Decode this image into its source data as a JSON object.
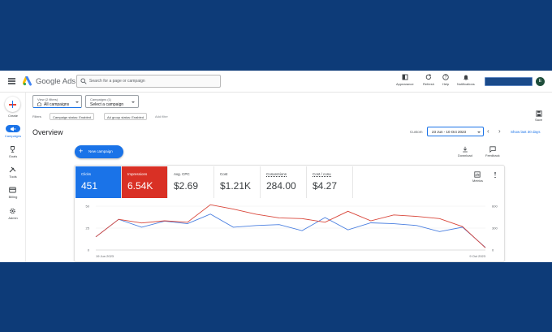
{
  "header": {
    "brand": "Google Ads",
    "search_placeholder": "Search for a page or campaign",
    "tools": [
      {
        "icon": "appearance-icon",
        "label": "Appearance"
      },
      {
        "icon": "refresh-icon",
        "label": "Refresh"
      },
      {
        "icon": "help-icon",
        "label": "Help"
      },
      {
        "icon": "bell-icon",
        "label": "Notifications"
      }
    ],
    "avatar_initial": "E"
  },
  "leftnav": {
    "create_label": "Create",
    "items": [
      {
        "icon": "campaigns-icon",
        "label": "Campaigns",
        "active": true
      },
      {
        "icon": "trophy-icon",
        "label": "Goals"
      },
      {
        "icon": "tools-icon",
        "label": "Tools"
      },
      {
        "icon": "card-icon",
        "label": "Billing"
      },
      {
        "icon": "gear-icon",
        "label": "Admin"
      }
    ]
  },
  "filters": {
    "view_label": "View (2 filters)",
    "view_value": "All campaigns",
    "campaigns_label": "Campaigns (1)",
    "campaigns_value": "Select a campaign",
    "filters_label": "Filters",
    "chips": [
      "Campaign status: Enabled",
      "Ad group status: Enabled"
    ],
    "add_filter": "Add filter",
    "save_label": "Save"
  },
  "overview": {
    "title": "Overview",
    "custom_label": "Custom",
    "date_range": "23 Jun - 10 Oct 2023",
    "show_last": "Show last 30 days",
    "new_campaign": "New campaign",
    "download": "Download",
    "feedback": "Feedback",
    "metrics_label": "Metrics"
  },
  "metrics": [
    {
      "label": "Clicks",
      "value": "451",
      "style": "blue"
    },
    {
      "label": "Impressions",
      "value": "6.54K",
      "style": "red"
    },
    {
      "label": "Avg. CPC",
      "value": "$2.69",
      "style": "plain"
    },
    {
      "label": "Cost",
      "value": "$1.21K",
      "style": "plain"
    },
    {
      "label": "Conversions",
      "value": "284.00",
      "style": "plain"
    },
    {
      "label": "Cost / conv.",
      "value": "$4.27",
      "style": "plain"
    }
  ],
  "chart_data": {
    "type": "line",
    "x_start_label": "19 Jun 2023",
    "x_end_label": "9 Oct 2023",
    "left_ticks": [
      "50",
      "25",
      "0"
    ],
    "right_ticks": [
      "600",
      "300",
      "0"
    ],
    "ylim_left": [
      0,
      50
    ],
    "ylim_right": [
      0,
      600
    ],
    "colors": {
      "clicks": "#4a7fe0",
      "impressions": "#d9473b"
    },
    "series": [
      {
        "name": "Clicks",
        "axis": "left",
        "values": [
          15,
          35,
          26,
          33,
          30,
          41,
          26,
          28,
          29,
          22,
          37,
          23,
          31,
          30,
          28,
          21,
          26,
          3
        ]
      },
      {
        "name": "Impressions",
        "axis": "right",
        "values": [
          180,
          420,
          370,
          400,
          380,
          620,
          560,
          490,
          440,
          430,
          380,
          530,
          400,
          480,
          460,
          430,
          320,
          30
        ]
      }
    ]
  }
}
